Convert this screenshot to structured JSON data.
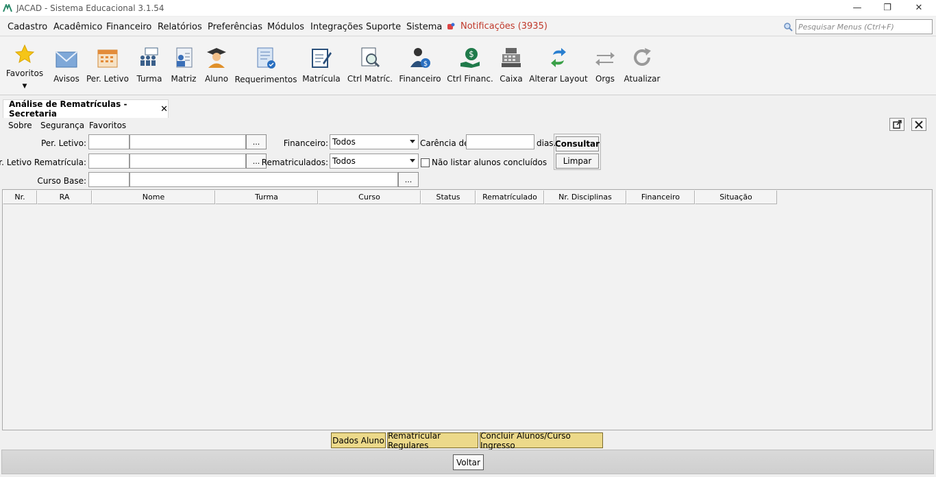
{
  "window": {
    "title": "JACAD - Sistema Educacional 3.1.54",
    "minimize": "—",
    "restore": "❐",
    "close": "✕"
  },
  "menu": {
    "items": [
      "Cadastro",
      "Acadêmico",
      "Financeiro",
      "Relatórios",
      "Preferências",
      "Módulos",
      "Integrações",
      "Suporte",
      "Sistema"
    ],
    "notifications": "Notificações (3935)",
    "search_placeholder": "Pesquisar Menus (Ctrl+F)"
  },
  "toolbar": {
    "favoritos": "Favoritos",
    "buttons": [
      "Avisos",
      "Per. Letivo",
      "Turma",
      "Matriz",
      "Aluno",
      "Requerimentos",
      "Matrícula",
      "Ctrl Matríc.",
      "Financeiro",
      "Ctrl Financ.",
      "Caixa",
      "Alterar Layout",
      "Orgs",
      "Atualizar"
    ]
  },
  "tab": {
    "label": "Análise de Rematrículas - Secretaria",
    "close": "✕"
  },
  "submenu": {
    "items": [
      "Sobre",
      "Segurança",
      "Favoritos"
    ]
  },
  "form": {
    "per_letivo_label": "Per. Letivo:",
    "per_letivo_remat_label": "Per. Letivo Rematrícula:",
    "curso_base_label": "Curso Base:",
    "dots": "...",
    "financeiro_label": "Financeiro:",
    "financeiro_value": "Todos",
    "rematriculados_label": "Rematriculados:",
    "rematriculados_value": "Todos",
    "carencia_label": "Carência de:",
    "dias_label": "dias.",
    "nao_listar_label": "Não listar alunos concluídos",
    "consultar": "Consultar",
    "limpar": "Limpar"
  },
  "grid": {
    "columns": [
      "Nr.",
      "RA",
      "Nome",
      "Turma",
      "Curso",
      "Status",
      "Rematrículado",
      "Nr. Disciplinas",
      "Financeiro",
      "Situação"
    ]
  },
  "actions": {
    "dados_aluno": "Dados Aluno",
    "rematricular": "Rematricular Regulares",
    "concluir": "Concluir Alunos/Curso Ingresso",
    "voltar": "Voltar"
  }
}
